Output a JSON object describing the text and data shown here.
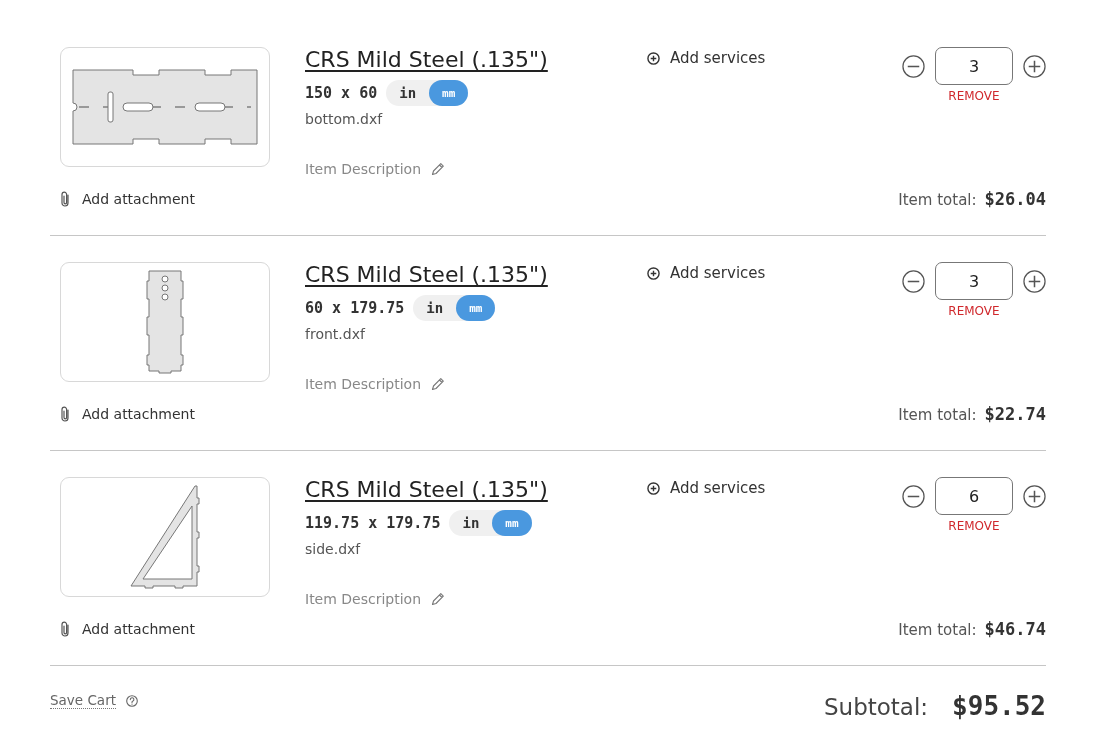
{
  "items": [
    {
      "kind": "wide",
      "title": "CRS Mild Steel (.135\")",
      "dimensions": "150 x 60",
      "units": [
        {
          "label": "in",
          "selected": false
        },
        {
          "label": "mm",
          "selected": true
        }
      ],
      "file": "bottom.dxf",
      "description": "Item Description",
      "attachment": "Add attachment",
      "services": "Add services",
      "quantity": "3",
      "remove": "REMOVE",
      "total_label": "Item total:",
      "total": "$26.04"
    },
    {
      "kind": "tall",
      "title": "CRS Mild Steel (.135\")",
      "dimensions": "60 x 179.75",
      "units": [
        {
          "label": "in",
          "selected": false
        },
        {
          "label": "mm",
          "selected": true
        }
      ],
      "file": "front.dxf",
      "description": "Item Description",
      "attachment": "Add attachment",
      "services": "Add services",
      "quantity": "3",
      "remove": "REMOVE",
      "total_label": "Item total:",
      "total": "$22.74"
    },
    {
      "kind": "triangle",
      "title": "CRS Mild Steel (.135\")",
      "dimensions": "119.75 x 179.75",
      "units": [
        {
          "label": "in",
          "selected": false
        },
        {
          "label": "mm",
          "selected": true
        }
      ],
      "file": "side.dxf",
      "description": "Item Description",
      "attachment": "Add attachment",
      "services": "Add services",
      "quantity": "6",
      "remove": "REMOVE",
      "total_label": "Item total:",
      "total": "$46.74"
    }
  ],
  "footer": {
    "save_cart": "Save Cart",
    "subtotal_label": "Subtotal:",
    "subtotal": "$95.52"
  }
}
